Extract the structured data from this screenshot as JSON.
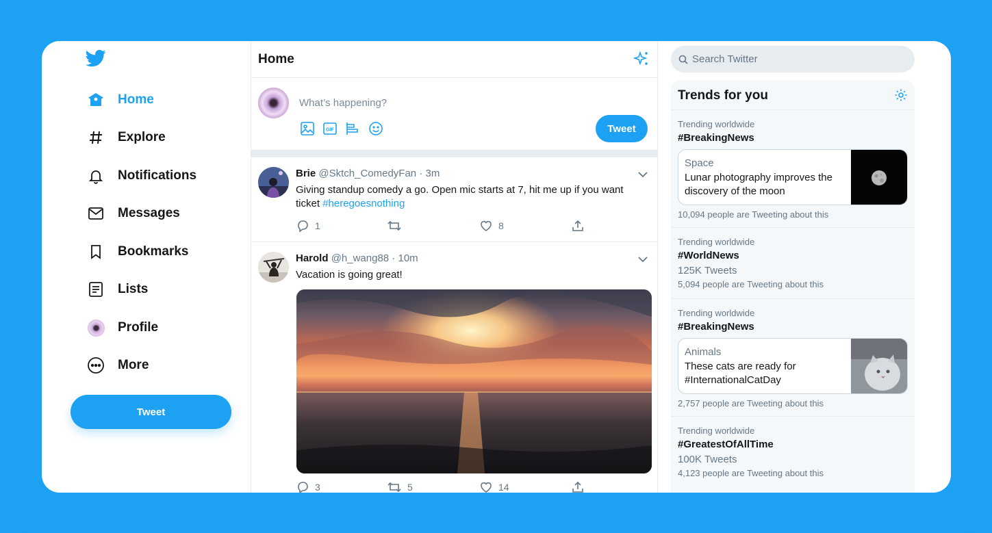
{
  "colors": {
    "brand": "#1da1f2",
    "text": "#14171a",
    "muted": "#657786",
    "border": "#e6ecf0"
  },
  "nav": {
    "items": [
      {
        "label": "Home",
        "icon": "home-icon",
        "active": true
      },
      {
        "label": "Explore",
        "icon": "hashtag-icon"
      },
      {
        "label": "Notifications",
        "icon": "bell-icon"
      },
      {
        "label": "Messages",
        "icon": "envelope-icon"
      },
      {
        "label": "Bookmarks",
        "icon": "bookmark-icon"
      },
      {
        "label": "Lists",
        "icon": "list-icon"
      },
      {
        "label": "Profile",
        "icon": "avatar"
      },
      {
        "label": "More",
        "icon": "more-icon"
      }
    ],
    "tweet_button": "Tweet"
  },
  "timeline": {
    "title": "Home",
    "compose": {
      "placeholder": "What’s happening?",
      "tweet_button": "Tweet"
    },
    "tweets": [
      {
        "name": "Brie",
        "meta": "@Sktch_ComedyFan · 3m",
        "text": "Giving standup comedy a go. Open mic starts at 7, hit me up if you want ticket ",
        "hashtag": "#heregoesnothing",
        "replies": "1",
        "retweets": "",
        "likes": "8"
      },
      {
        "name": "Harold",
        "meta": "@h_wang88 · 10m",
        "text": "Vacation is going great!",
        "replies": "3",
        "retweets": "5",
        "likes": "14"
      }
    ]
  },
  "search": {
    "placeholder": "Search Twitter"
  },
  "trends": {
    "title": "Trends for you",
    "items": [
      {
        "context": "Trending worldwide",
        "tag": "#BreakingNews",
        "card": {
          "category": "Space",
          "text": "Lunar photography improves the discovery of the moon"
        },
        "people": "10,094 people are Tweeting about this"
      },
      {
        "context": "Trending worldwide",
        "tag": "#WorldNews",
        "count": "125K Tweets",
        "people": "5,094 people are Tweeting about this"
      },
      {
        "context": "Trending worldwide",
        "tag": "#BreakingNews",
        "card": {
          "category": "Animals",
          "text": "These cats are ready for #InternationalCatDay"
        },
        "people": "2,757 people are Tweeting about this"
      },
      {
        "context": "Trending worldwide",
        "tag": "#GreatestOfAllTime",
        "count": "100K Tweets",
        "people": "4,123 people are Tweeting about this"
      }
    ]
  }
}
